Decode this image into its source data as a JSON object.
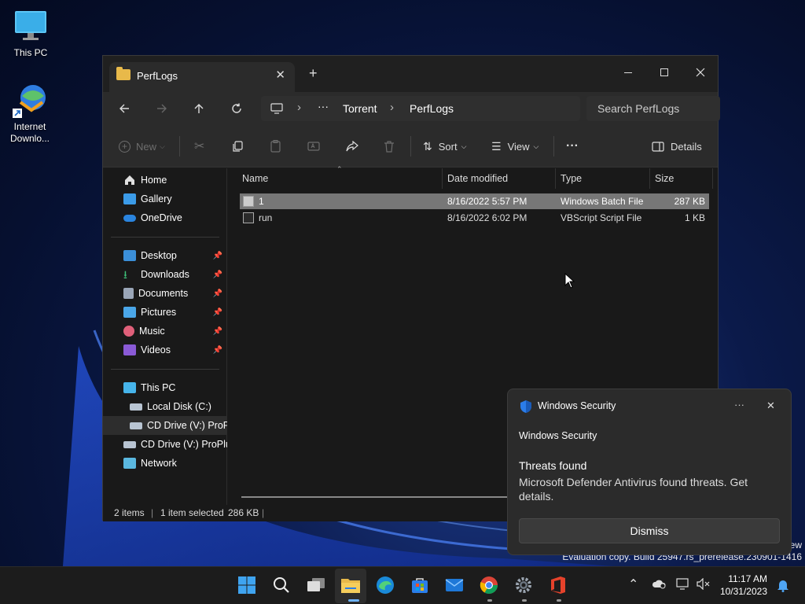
{
  "desktop": {
    "icons": [
      {
        "label": "This PC"
      },
      {
        "label": "Internet Downlo..."
      }
    ]
  },
  "explorer": {
    "tab_title": "PerfLogs",
    "tab_close": "✕",
    "new_tab": "+",
    "breadcrumb": {
      "ellipsis": "···",
      "items": [
        "Torrent",
        "PerfLogs"
      ]
    },
    "search_placeholder": "Search PerfLogs",
    "toolbar": {
      "new_label": "New",
      "sort_label": "Sort",
      "view_label": "View",
      "more_label": "···",
      "details_label": "Details"
    },
    "sidebar": {
      "items": [
        {
          "label": "Home"
        },
        {
          "label": "Gallery"
        },
        {
          "label": "OneDrive"
        },
        {
          "label": "Desktop"
        },
        {
          "label": "Downloads"
        },
        {
          "label": "Documents"
        },
        {
          "label": "Pictures"
        },
        {
          "label": "Music"
        },
        {
          "label": "Videos"
        },
        {
          "label": "This PC"
        },
        {
          "label": "Local Disk (C:)"
        },
        {
          "label": "CD Drive (V:) ProPlu"
        },
        {
          "label": "CD Drive (V:) ProPlus"
        },
        {
          "label": "Network"
        }
      ]
    },
    "columns": [
      "Name",
      "Date modified",
      "Type",
      "Size"
    ],
    "files": [
      {
        "name": "1",
        "date": "8/16/2022 5:57 PM",
        "type": "Windows Batch File",
        "size": "287 KB",
        "selected": true
      },
      {
        "name": "run",
        "date": "8/16/2022 6:02 PM",
        "type": "VBScript Script File",
        "size": "1 KB",
        "selected": false
      }
    ],
    "status": {
      "items": "2 items",
      "selected": "1 item selected",
      "size": "286 KB"
    }
  },
  "toast": {
    "app_name": "Windows Security",
    "more": "···",
    "close": "✕",
    "source": "Windows Security",
    "heading": "Threats found",
    "body": "Microsoft Defender Antivirus found threats. Get details.",
    "button": "Dismiss"
  },
  "watermark": {
    "line1": "ew",
    "line2": "Evaluation copy. Build 25947.rs_prerelease.230901-1416"
  },
  "taskbar": {
    "time": "11:17 AM",
    "date": "10/31/2023"
  },
  "colors": {
    "accent": "#0078d4",
    "folder": "#e8b94a",
    "selection": "#777777"
  }
}
